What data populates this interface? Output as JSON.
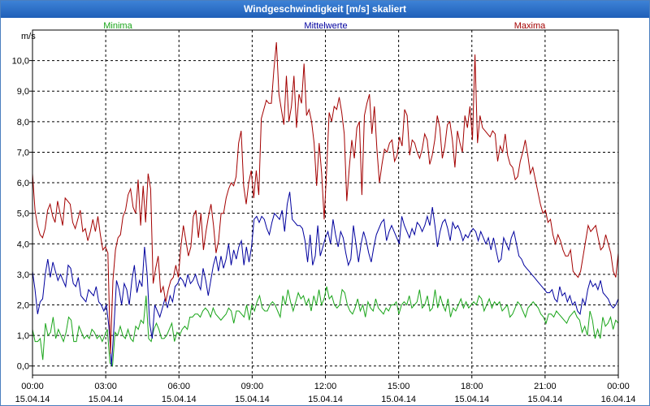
{
  "window": {
    "title": "Windgeschwindigkeit [m/s] skaliert"
  },
  "chart_data": {
    "type": "line",
    "title": "Windgeschwindigkeit [m/s] skaliert",
    "ylabel": "m/s",
    "xlabel": "",
    "ylim": [
      -0.3,
      11.0
    ],
    "xlim": [
      0,
      24
    ],
    "grid": true,
    "legend_position": "top",
    "y_ticks": [
      "0,0",
      "1,0",
      "2,0",
      "3,0",
      "4,0",
      "5,0",
      "6,0",
      "7,0",
      "8,0",
      "9,0",
      "10,0"
    ],
    "y_tick_values": [
      0,
      1,
      2,
      3,
      4,
      5,
      6,
      7,
      8,
      9,
      10
    ],
    "x_ticks": [
      {
        "t": "00:00",
        "d": "15.04.14",
        "h": 0
      },
      {
        "t": "03:00",
        "d": "15.04.14",
        "h": 3
      },
      {
        "t": "06:00",
        "d": "15.04.14",
        "h": 6
      },
      {
        "t": "09:00",
        "d": "15.04.14",
        "h": 9
      },
      {
        "t": "12:00",
        "d": "15.04.14",
        "h": 12
      },
      {
        "t": "15:00",
        "d": "15.04.14",
        "h": 15
      },
      {
        "t": "18:00",
        "d": "15.04.14",
        "h": 18
      },
      {
        "t": "21:00",
        "d": "15.04.14",
        "h": 21
      },
      {
        "t": "00:00",
        "d": "16.04.14",
        "h": 24
      }
    ],
    "series": [
      {
        "name": "Minima",
        "color": "#1aa51a",
        "values": [
          1.2,
          0.8,
          0.8,
          0.9,
          0.2,
          1.4,
          1.0,
          1.1,
          1.6,
          0.9,
          1.2,
          1.0,
          0.8,
          1.1,
          1.6,
          1.5,
          0.8,
          0.8,
          1.3,
          1.1,
          0.9,
          1.0,
          0.9,
          1.2,
          1.1,
          0.9,
          1.0,
          0.8,
          1.0,
          1.2,
          0.1,
          0.0,
          1.1,
          1.0,
          1.3,
          1.0,
          0.9,
          1.2,
          0.9,
          0.8,
          1.3,
          1.2,
          1.5,
          1.4,
          2.3,
          0.9,
          0.8,
          1.2,
          1.4,
          1.2,
          0.9,
          0.9,
          1.0,
          1.2,
          1.4,
          0.8,
          1.1,
          1.0,
          1.2,
          1.3,
          1.2,
          1.6,
          1.6,
          1.7,
          1.7,
          1.6,
          1.8,
          1.9,
          1.8,
          1.6,
          1.9,
          1.7,
          1.6,
          1.5,
          1.6,
          1.7,
          1.9,
          1.8,
          1.4,
          1.8,
          1.8,
          1.7,
          1.6,
          2.0,
          1.5,
          2.0,
          1.8,
          2.1,
          2.3,
          1.9,
          1.8,
          1.8,
          2.0,
          2.1,
          2.0,
          1.8,
          1.6,
          2.3,
          2.0,
          2.5,
          2.1,
          1.8,
          2.1,
          2.4,
          2.2,
          2.3,
          2.0,
          2.2,
          1.8,
          2.3,
          2.0,
          2.5,
          2.0,
          2.2,
          2.6,
          2.2,
          2.3,
          2.0,
          1.9,
          2.0,
          2.5,
          2.4,
          2.0,
          1.8,
          1.7,
          1.9,
          2.2,
          1.8,
          2.0,
          1.6,
          2.1,
          1.9,
          1.8,
          2.2,
          1.9,
          1.8,
          1.7,
          1.9,
          1.8,
          2.0,
          2.0,
          2.1,
          1.7,
          2.0,
          2.1,
          2.0,
          2.3,
          1.9,
          2.0,
          2.1,
          2.5,
          1.9,
          2.0,
          2.3,
          1.8,
          1.9,
          2.5,
          1.9,
          2.3,
          2.0,
          1.8,
          2.2,
          1.6,
          1.9,
          1.8,
          2.0,
          2.2,
          1.9,
          2.1,
          1.9,
          2.0,
          2.1,
          2.0,
          2.3,
          2.2,
          1.8,
          2.0,
          2.2,
          1.9,
          2.1,
          2.0,
          2.1,
          1.8,
          1.9,
          2.0,
          1.6,
          1.7,
          1.9,
          2.1,
          2.0,
          1.8,
          1.6,
          1.9,
          2.0,
          2.1,
          2.0,
          1.9,
          1.7,
          1.6,
          1.4,
          1.7,
          1.7,
          1.6,
          1.8,
          1.7,
          1.6,
          1.5,
          1.4,
          1.6,
          1.7,
          1.8,
          1.6,
          1.5,
          1.1,
          1.3,
          1.0,
          1.8,
          1.5,
          0.9,
          1.2,
          0.9,
          1.6,
          1.3,
          1.4,
          1.6,
          1.2,
          1.5,
          1.4
        ]
      },
      {
        "name": "Mittelwerte",
        "color": "#00009e",
        "values": [
          3.1,
          2.5,
          1.7,
          2.1,
          2.2,
          3.0,
          3.5,
          2.9,
          3.4,
          3.1,
          2.8,
          3.0,
          2.8,
          2.6,
          3.3,
          3.2,
          2.7,
          2.6,
          2.9,
          2.3,
          2.2,
          2.1,
          2.5,
          2.4,
          2.3,
          2.6,
          2.1,
          2.0,
          1.8,
          2.0,
          1.3,
          0.0,
          1.3,
          2.8,
          2.5,
          2.0,
          2.7,
          2.5,
          2.0,
          2.8,
          3.3,
          2.4,
          2.8,
          2.6,
          3.9,
          3.0,
          1.4,
          0.9,
          2.0,
          1.8,
          1.6,
          1.9,
          2.2,
          1.9,
          2.3,
          2.1,
          2.6,
          2.7,
          2.9,
          2.8,
          2.6,
          3.0,
          2.7,
          2.8,
          3.0,
          2.7,
          2.5,
          3.2,
          2.8,
          2.3,
          2.8,
          3.3,
          3.6,
          3.1,
          3.6,
          3.2,
          3.5,
          4.0,
          3.3,
          3.8,
          3.5,
          3.9,
          4.1,
          3.3,
          3.9,
          3.4,
          3.9,
          4.8,
          4.9,
          4.7,
          4.9,
          4.8,
          4.5,
          4.3,
          4.7,
          5.0,
          4.9,
          4.8,
          5.1,
          4.4,
          5.3,
          5.7,
          4.8,
          4.7,
          4.6,
          4.6,
          4.5,
          4.1,
          3.4,
          4.3,
          3.3,
          3.6,
          4.6,
          3.6,
          3.9,
          4.2,
          4.4,
          4.0,
          4.8,
          4.3,
          3.9,
          4.4,
          4.2,
          3.7,
          3.3,
          3.5,
          4.6,
          4.0,
          3.4,
          4.0,
          4.4,
          4.1,
          3.7,
          3.4,
          3.9,
          4.3,
          4.5,
          4.7,
          4.8,
          4.1,
          4.4,
          4.6,
          4.4,
          4.2,
          4.0,
          4.9,
          4.6,
          4.4,
          4.2,
          4.5,
          4.3,
          4.7,
          4.6,
          4.4,
          4.6,
          4.9,
          4.6,
          5.2,
          4.6,
          3.9,
          4.4,
          4.7,
          4.8,
          4.5,
          4.1,
          4.7,
          4.5,
          4.6,
          4.4,
          4.1,
          4.3,
          4.2,
          4.4,
          4.5,
          4.4,
          4.1,
          4.4,
          4.2,
          4.0,
          4.2,
          3.8,
          4.2,
          3.8,
          3.4,
          3.5,
          4.2,
          4.0,
          3.8,
          4.2,
          4.4,
          4.0,
          3.6,
          3.5,
          3.3,
          3.2,
          3.1,
          3.0,
          2.9,
          2.8,
          2.7,
          2.6,
          2.5,
          2.4,
          2.4,
          2.5,
          2.2,
          2.1,
          2.6,
          2.3,
          2.4,
          2.1,
          2.3,
          2.0,
          2.1,
          1.8,
          1.7,
          2.2,
          2.0,
          2.5,
          2.8,
          2.6,
          2.7,
          2.5,
          2.8,
          2.4,
          2.3,
          2.2,
          2.0,
          1.9,
          2.0,
          2.2
        ]
      },
      {
        "name": "Maxima",
        "color": "#a30000",
        "values": [
          6.3,
          5.1,
          4.6,
          4.3,
          4.2,
          4.5,
          5.1,
          5.3,
          4.9,
          4.7,
          5.4,
          5.0,
          4.6,
          5.5,
          5.4,
          5.3,
          4.7,
          4.5,
          4.8,
          5.1,
          4.4,
          4.5,
          4.1,
          4.4,
          4.8,
          4.4,
          4.9,
          4.3,
          3.8,
          3.9,
          3.7,
          0.4,
          2.8,
          3.8,
          4.2,
          4.3,
          4.9,
          5.1,
          5.6,
          5.8,
          5.2,
          5.0,
          6.1,
          4.6,
          5.9,
          4.7,
          6.3,
          5.8,
          2.7,
          3.2,
          3.6,
          2.4,
          2.6,
          2.1,
          2.5,
          2.8,
          2.9,
          3.3,
          2.9,
          3.9,
          4.6,
          4.1,
          3.6,
          3.9,
          4.9,
          5.1,
          4.2,
          5.0,
          3.8,
          4.4,
          4.9,
          5.3,
          4.6,
          3.7,
          4.1,
          5.0,
          5.0,
          5.5,
          5.8,
          6.0,
          5.9,
          6.2,
          7.3,
          7.7,
          5.9,
          5.3,
          6.0,
          6.4,
          5.5,
          6.4,
          5.6,
          8.1,
          8.4,
          8.7,
          8.6,
          8.6,
          9.7,
          10.6,
          8.9,
          8.4,
          7.9,
          9.5,
          8.0,
          8.5,
          9.5,
          7.8,
          8.9,
          8.6,
          9.9,
          8.2,
          8.4,
          8.0,
          7.3,
          5.9,
          7.3,
          6.3,
          4.8,
          6.4,
          8.3,
          8.0,
          8.5,
          8.4,
          8.8,
          8.3,
          7.6,
          5.4,
          6.5,
          7.4,
          6.8,
          7.8,
          8.0,
          5.6,
          8.2,
          8.6,
          8.9,
          7.6,
          8.5,
          7.1,
          6.0,
          6.6,
          7.1,
          7.0,
          7.3,
          7.4,
          6.7,
          6.9,
          7.5,
          7.2,
          8.4,
          8.2,
          6.9,
          7.4,
          7.3,
          7.0,
          6.8,
          7.1,
          7.6,
          7.4,
          6.6,
          6.9,
          7.4,
          8.2,
          7.8,
          6.8,
          7.2,
          7.9,
          8.0,
          7.4,
          6.5,
          7.7,
          7.3,
          7.0,
          8.2,
          7.8,
          8.5,
          7.4,
          10.2,
          7.3,
          8.2,
          7.8,
          7.7,
          7.6,
          7.5,
          7.7,
          7.6,
          6.7,
          7.2,
          7.0,
          7.6,
          6.9,
          6.6,
          6.5,
          6.1,
          6.2,
          6.7,
          7.0,
          7.4,
          6.9,
          6.3,
          6.5,
          6.1,
          5.7,
          5.3,
          5.0,
          5.1,
          4.7,
          4.8,
          4.3,
          4.0,
          4.3,
          4.1,
          3.8,
          3.6,
          3.6,
          3.8,
          3.1,
          3.0,
          2.9,
          3.1,
          3.6,
          4.1,
          4.6,
          4.4,
          4.5,
          4.6,
          4.2,
          3.8,
          3.9,
          4.3,
          4.0,
          3.7,
          3.1,
          2.9,
          3.7
        ]
      }
    ]
  }
}
